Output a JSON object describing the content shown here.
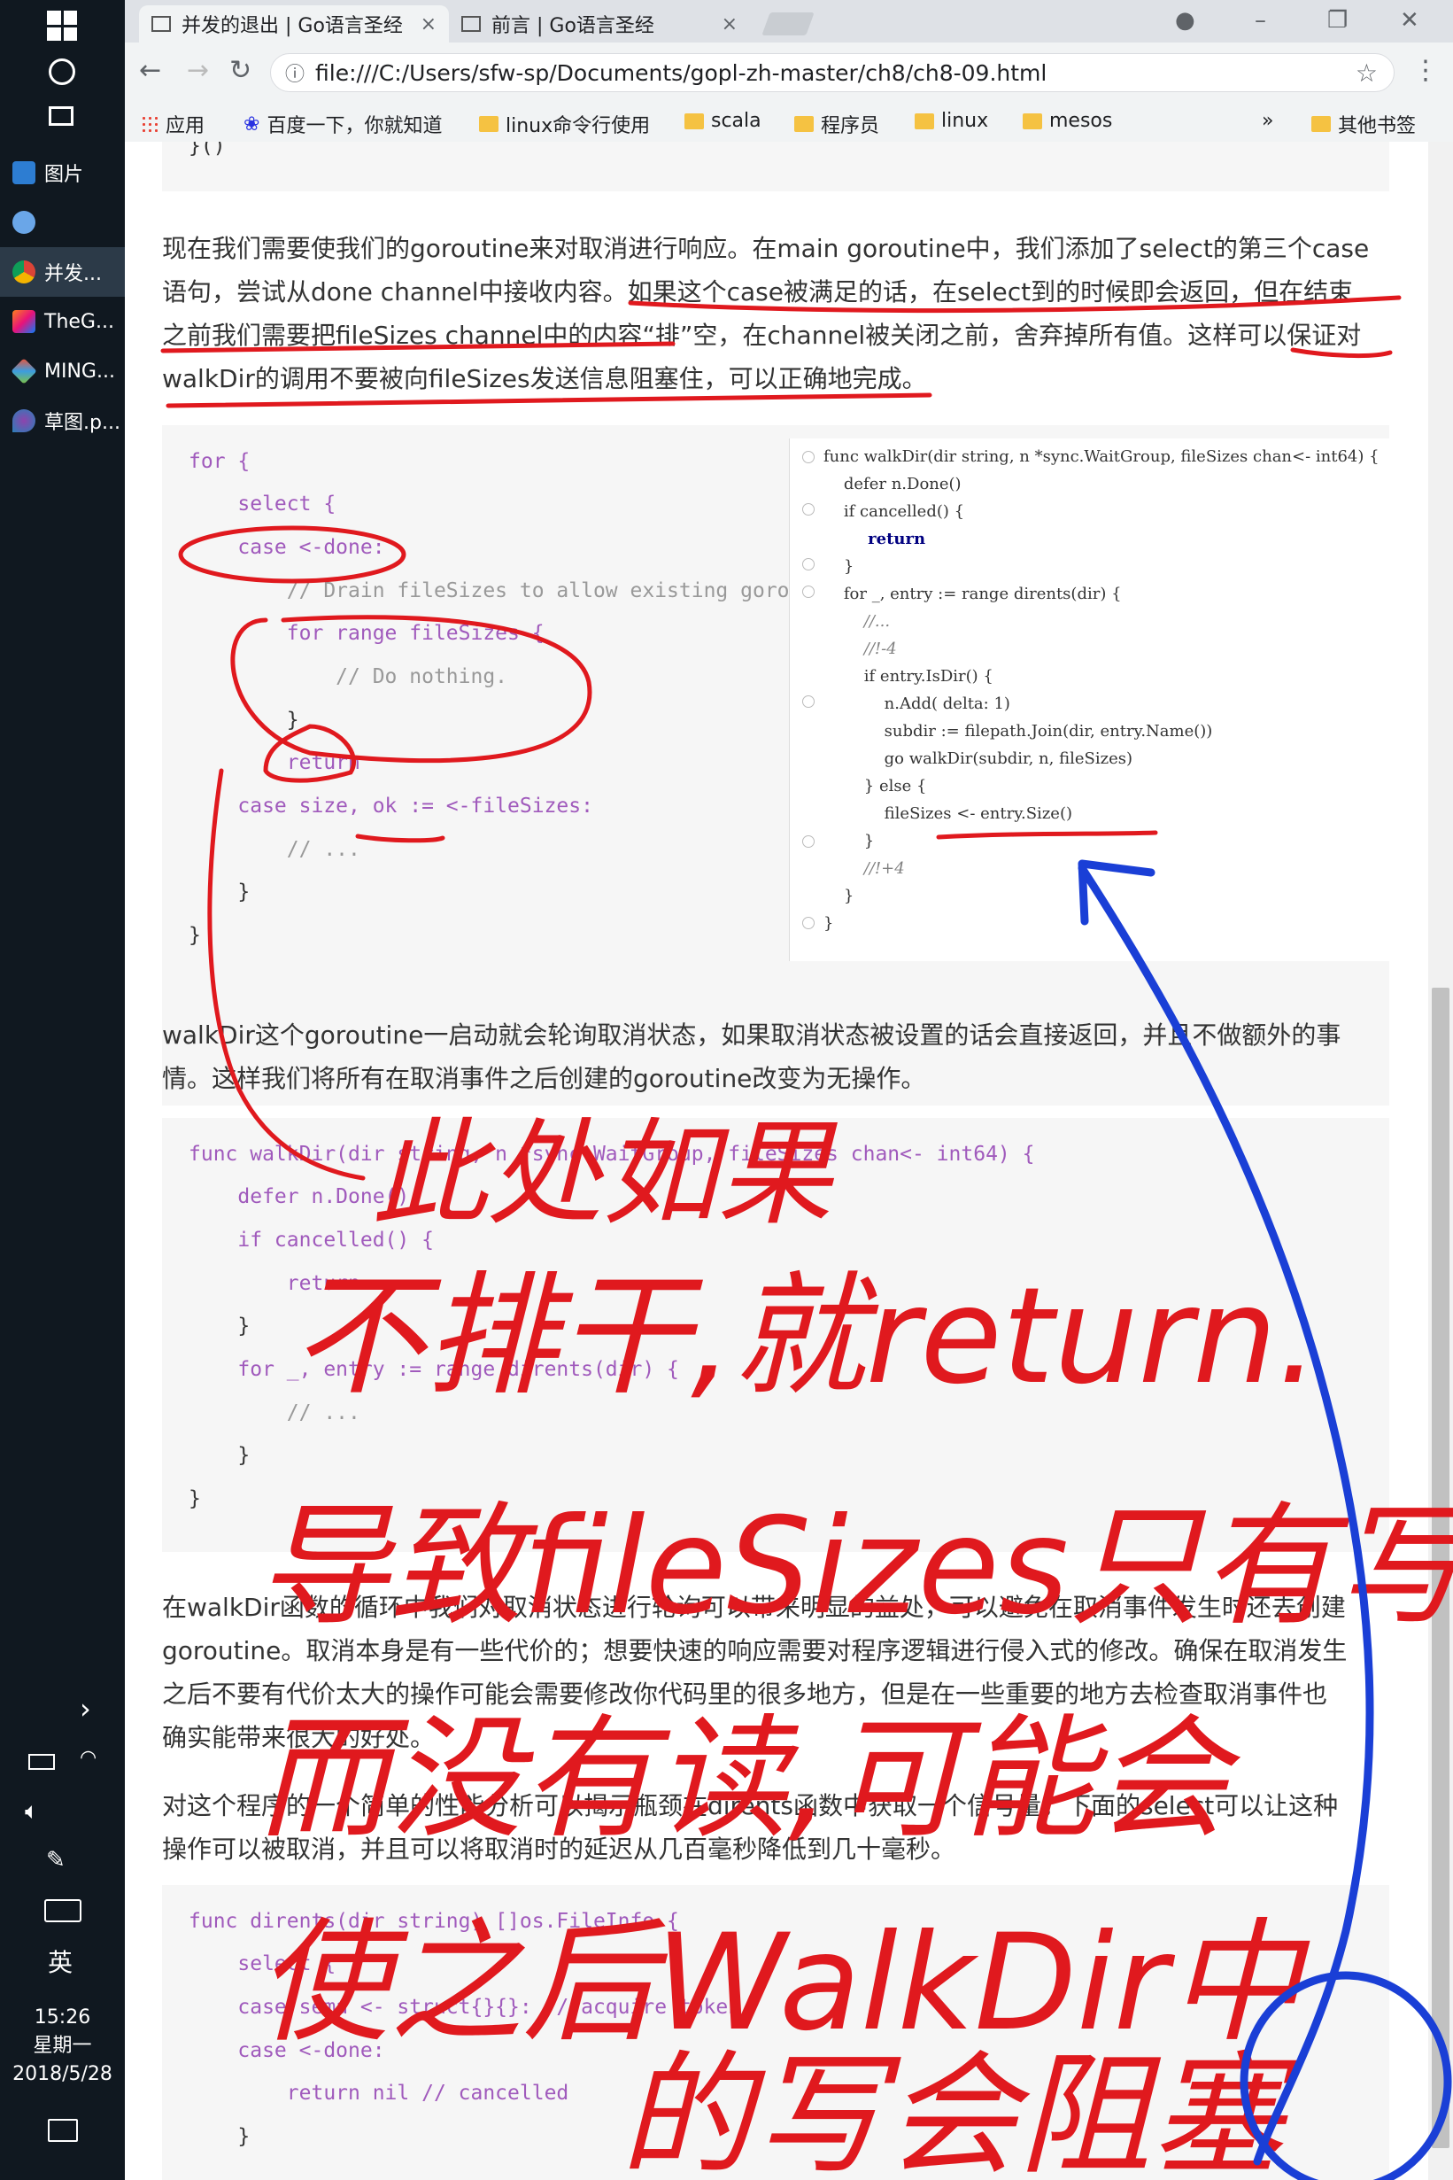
{
  "taskbar": {
    "items": [
      {
        "label": "图片",
        "icon": "photos-icon"
      },
      {
        "label": "",
        "icon": "paint-icon"
      },
      {
        "label": "并发...",
        "icon": "chrome-icon"
      },
      {
        "label": "TheG...",
        "icon": "intellij-icon"
      },
      {
        "label": "MING...",
        "icon": "git-icon"
      },
      {
        "label": "草图.p...",
        "icon": "pen-icon"
      }
    ],
    "ime": "英",
    "time": "15:26",
    "weekday": "星期一",
    "date": "2018/5/28"
  },
  "browser": {
    "tabs": [
      {
        "title": "并发的退出 | Go语言圣经",
        "active": true
      },
      {
        "title": "前言 | Go语言圣经",
        "active": false
      }
    ],
    "url": "file:///C:/Users/sfw-sp/Documents/gopl-zh-master/ch8/ch8-09.html",
    "bookmarks": [
      "应用",
      "百度一下，你就知道",
      "linux命令行使用",
      "scala",
      "程序员",
      "linux",
      "mesos"
    ],
    "more_bookmarks": "»",
    "other_bookmarks": "其他书签"
  },
  "content": {
    "top_code_tail": "}()",
    "para1": [
      "现在我们需要使我们的goroutine来对取消进行响应。在main goroutine中，我们添加了select的第三个case",
      "语句，尝试从done channel中接收内容。如果这个case被满足的话，在select到的时候即会返回，但在结束",
      "之前我们需要把fileSizes channel中的内容“排”空，在channel被关闭之前，舍弃掉所有值。这样可以保证对",
      "walkDir的调用不要被向fileSizes发送信息阻塞住，可以正确地完成。"
    ],
    "code1": [
      "for {",
      "    select {",
      "    case <-done:",
      "        // Drain fileSizes to allow existing goro",
      "        for range fileSizes {",
      "            // Do nothing.",
      "        }",
      "        return",
      "    case size, ok := <-fileSizes:",
      "        // ...",
      "    }",
      "}"
    ],
    "ide_code": [
      "func walkDir(dir string, n *sync.WaitGroup, fileSizes chan<- int64) {",
      "    defer n.Done()",
      "    if cancelled() {",
      "        return",
      "    }",
      "    for _, entry := range dirents(dir) {",
      "        //...",
      "        //!-4",
      "        if entry.IsDir() {",
      "            n.Add( delta: 1)",
      "            subdir := filepath.Join(dir, entry.Name())",
      "            go walkDir(subdir, n, fileSizes)",
      "        } else {",
      "            fileSizes <- entry.Size()",
      "        }",
      "        //!+4",
      "    }",
      "}"
    ],
    "para2": [
      "walkDir这个goroutine一启动就会轮询取消状态，如果取消状态被设置的话会直接返回，并且不做额外的事",
      "情。这样我们将所有在取消事件之后创建的goroutine改变为无操作。"
    ],
    "code2": [
      "func walkDir(dir string, n *sync.WaitGroup, fileSizes chan<- int64) {",
      "    defer n.Done()",
      "    if cancelled() {",
      "        return",
      "    }",
      "    for _, entry := range dirents(dir) {",
      "        // ...",
      "    }",
      "}"
    ],
    "para3": [
      "在walkDir函数的循环中我们对取消状态进行轮询可以带来明显的益处，可以避免在取消事件发生时还去创建",
      "goroutine。取消本身是有一些代价的；想要快速的响应需要对程序逻辑进行侵入式的修改。确保在取消发生",
      "之后不要有代价太大的操作可能会需要修改你代码里的很多地方，但是在一些重要的地方去检查取消事件也",
      "确实能带来很大的好处。"
    ],
    "para4": [
      "对这个程序的一个简单的性能分析可以揭示瓶颈在dirents函数中获取一个信号量。下面的select可以让这种",
      "操作可以被取消，并且可以将取消时的延迟从几百毫秒降低到几十毫秒。"
    ],
    "code3": [
      "func dirents(dir string) []os.FileInfo {",
      "    select {",
      "    case sema <- struct{}{}: // acquire token",
      "    case <-done:",
      "        return nil // cancelled",
      "    }"
    ]
  },
  "annotations": {
    "line1": "此处如果",
    "line2": "不排干,就return.",
    "line3": "导致fileSizes只有写",
    "line4": "而没有读,可能会",
    "line5": "使之后WalkDir中",
    "line6": "的写会阻塞",
    "color_red": "#e0191e",
    "color_blue": "#1a3fd6"
  }
}
